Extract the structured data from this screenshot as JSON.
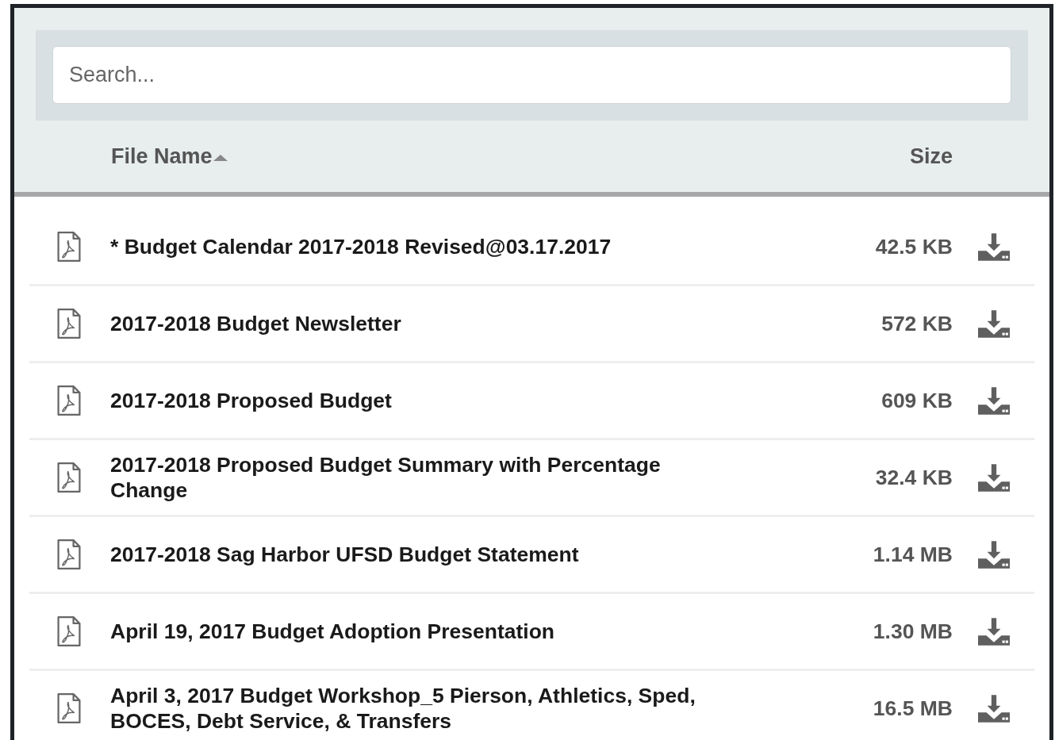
{
  "search": {
    "placeholder": "Search..."
  },
  "columns": [
    {
      "label": "File Name",
      "sorted_ascending": true
    },
    {
      "label": "Size",
      "sorted_ascending": false
    }
  ],
  "files": [
    {
      "name": "* Budget Calendar 2017-2018 Revised@03.17.2017",
      "size": "42.5 KB"
    },
    {
      "name": "2017-2018 Budget Newsletter",
      "size": "572 KB"
    },
    {
      "name": "2017-2018 Proposed Budget",
      "size": "609 KB"
    },
    {
      "name": "2017-2018 Proposed Budget Summary with Percentage Change",
      "size": "32.4 KB"
    },
    {
      "name": "2017-2018 Sag Harbor UFSD Budget Statement",
      "size": "1.14 MB"
    },
    {
      "name": "April 19, 2017 Budget Adoption Presentation",
      "size": "1.30 MB"
    },
    {
      "name": "April 3, 2017 Budget Workshop_5 Pierson, Athletics, Sped, BOCES, Debt Service, & Transfers",
      "size": "16.5 MB"
    }
  ]
}
